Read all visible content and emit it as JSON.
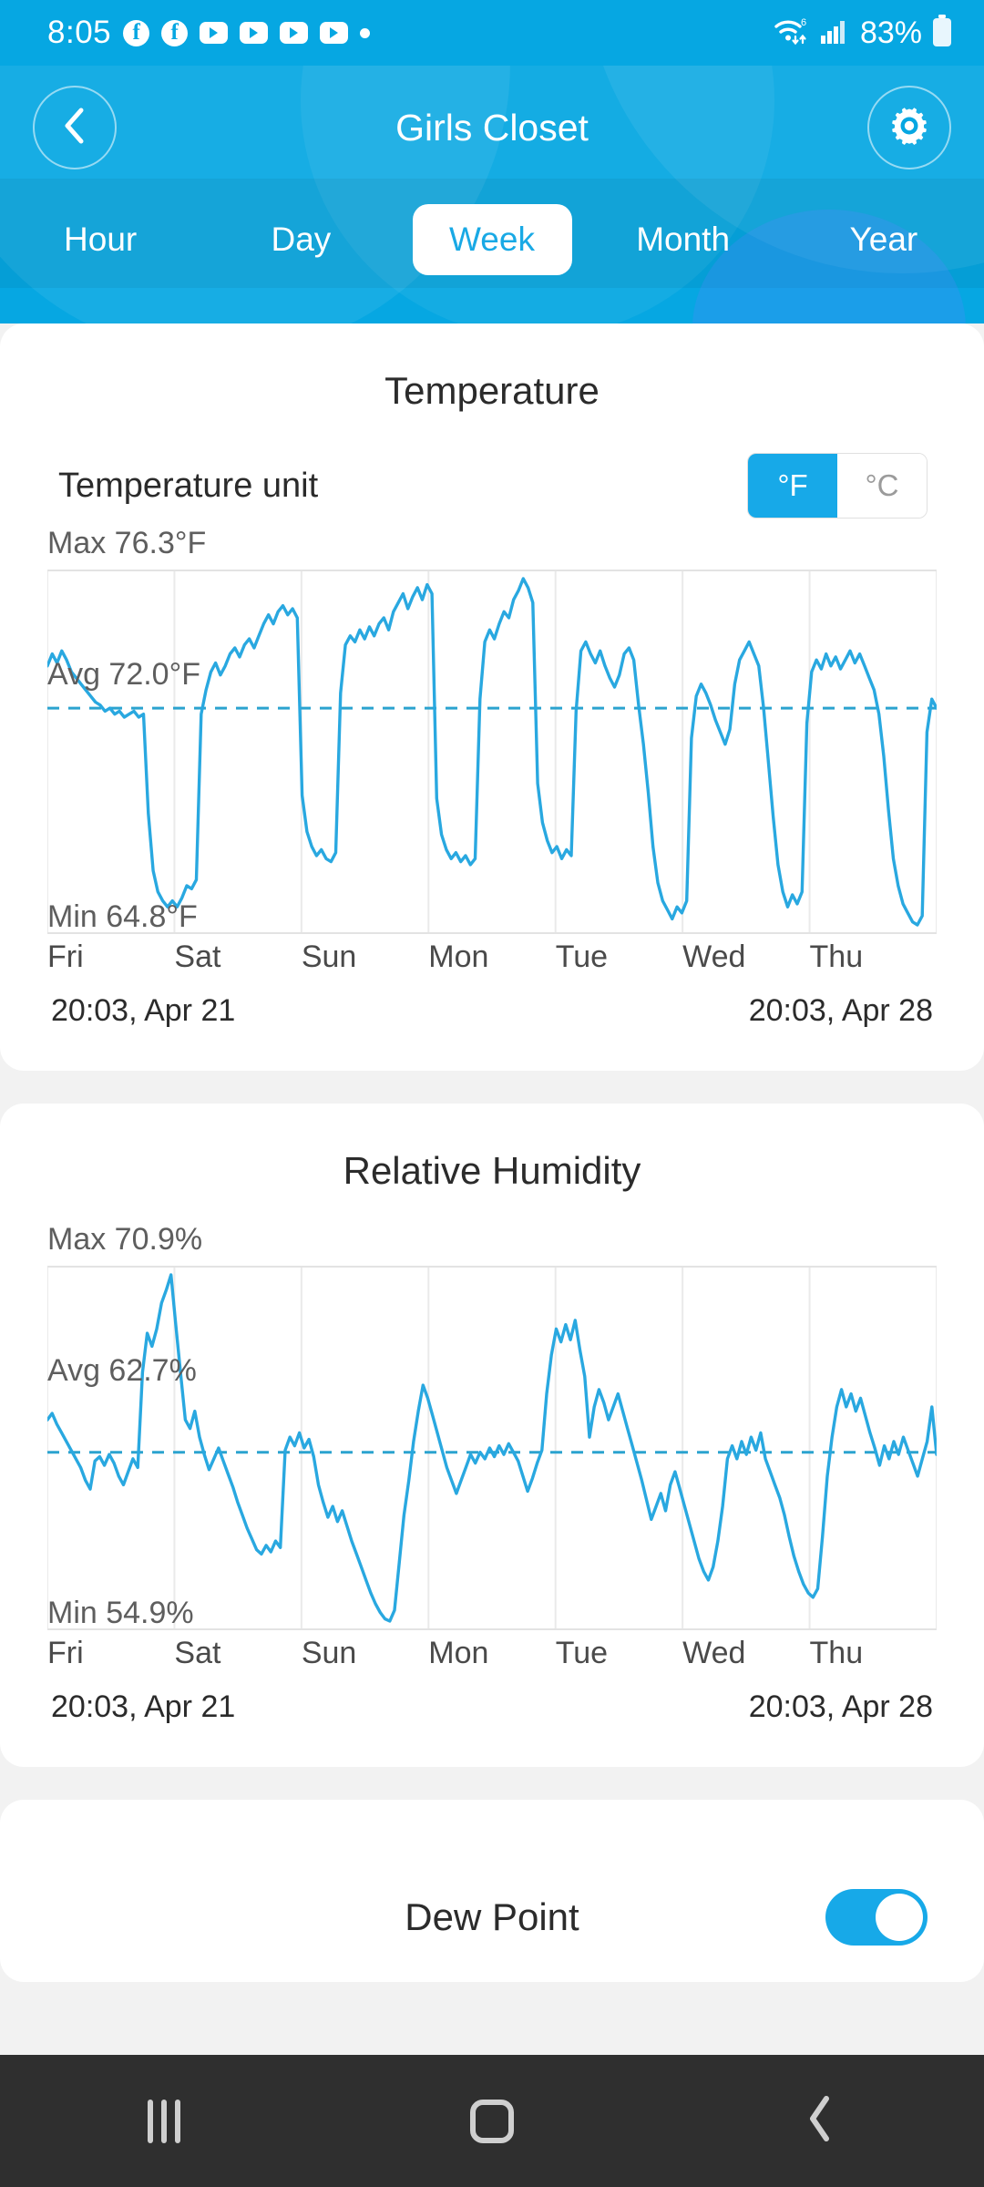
{
  "status_bar": {
    "time": "8:05",
    "icons": [
      "facebook-icon",
      "facebook-icon",
      "youtube-icon",
      "youtube-icon",
      "youtube-icon",
      "youtube-icon",
      "dot-icon"
    ],
    "wifi": "wifi-6-icon",
    "signal": "cellular-signal-icon",
    "battery_percent": "83%",
    "battery_icon": "battery-icon"
  },
  "header": {
    "back_icon": "chevron-left-icon",
    "title": "Girls Closet",
    "settings_icon": "gear-icon",
    "accent_color": "#06a7e2"
  },
  "tabs": [
    {
      "label": "Hour",
      "selected": false
    },
    {
      "label": "Day",
      "selected": false
    },
    {
      "label": "Week",
      "selected": true
    },
    {
      "label": "Month",
      "selected": false
    },
    {
      "label": "Year",
      "selected": false
    }
  ],
  "temperature_card": {
    "title": "Temperature",
    "unit_label": "Temperature unit",
    "unit_options": [
      "°F",
      "°C"
    ],
    "unit_selected": "°F",
    "max": "Max 76.3°F",
    "avg": "Avg 72.0°F",
    "min": "Min 64.8°F",
    "days": [
      "Fri",
      "Sat",
      "Sun",
      "Mon",
      "Tue",
      "Wed",
      "Thu"
    ],
    "range_start": "20:03,  Apr 21",
    "range_end": "20:03,  Apr 28"
  },
  "humidity_card": {
    "title": "Relative Humidity",
    "max": "Max 70.9%",
    "avg": "Avg 62.7%",
    "min": "Min 54.9%",
    "days": [
      "Fri",
      "Sat",
      "Sun",
      "Mon",
      "Tue",
      "Wed",
      "Thu"
    ],
    "range_start": "20:03,  Apr 21",
    "range_end": "20:03,  Apr 28"
  },
  "dew_point_card": {
    "title": "Dew Point",
    "toggle_on": true
  },
  "nav_bar": {
    "recents_icon": "recents-icon",
    "home_icon": "home-icon",
    "back_icon": "back-chevron-icon"
  },
  "chart_data": [
    {
      "type": "line",
      "title": "Temperature",
      "ylabel": "°F",
      "xlabel": "",
      "unit": "°F",
      "max": 76.3,
      "avg": 72.0,
      "min": 64.8,
      "ylim": [
        64.8,
        76.3
      ],
      "grid": true,
      "legend": "none",
      "avg_line": 72.0,
      "categories": [
        "Fri",
        "Sat",
        "Sun",
        "Mon",
        "Tue",
        "Wed",
        "Thu"
      ],
      "x_start": "20:03, Apr 21",
      "x_end": "20:03, Apr 28",
      "line_color": "#29a8e0",
      "values": [
        73.4,
        73.8,
        73.5,
        73.9,
        73.6,
        73.2,
        73.0,
        72.8,
        72.6,
        72.4,
        72.2,
        72.1,
        71.9,
        72.0,
        71.8,
        71.9,
        71.7,
        71.8,
        71.9,
        71.7,
        71.8,
        68.5,
        66.6,
        65.9,
        65.6,
        65.4,
        65.6,
        65.4,
        65.7,
        66.1,
        66.0,
        66.3,
        71.8,
        72.6,
        73.2,
        73.5,
        73.1,
        73.4,
        73.8,
        74.0,
        73.7,
        74.1,
        74.3,
        74.0,
        74.4,
        74.8,
        75.1,
        74.8,
        75.2,
        75.4,
        75.1,
        75.3,
        75.0,
        69.1,
        67.9,
        67.4,
        67.1,
        67.3,
        67.0,
        66.9,
        67.2,
        72.5,
        74.1,
        74.4,
        74.2,
        74.6,
        74.3,
        74.7,
        74.4,
        74.8,
        75.0,
        74.6,
        75.2,
        75.5,
        75.8,
        75.3,
        75.7,
        76.0,
        75.6,
        76.1,
        75.8,
        69.0,
        67.8,
        67.3,
        67.0,
        67.2,
        66.9,
        67.1,
        66.8,
        67.0,
        72.3,
        74.2,
        74.6,
        74.3,
        74.8,
        75.2,
        75.0,
        75.6,
        75.9,
        76.3,
        76.0,
        75.5,
        69.5,
        68.2,
        67.6,
        67.2,
        67.4,
        67.0,
        67.3,
        67.1,
        71.9,
        73.9,
        74.2,
        73.8,
        73.5,
        73.9,
        73.4,
        73.0,
        72.7,
        73.1,
        73.8,
        74.0,
        73.6,
        72.1,
        70.8,
        69.2,
        67.4,
        66.2,
        65.6,
        65.3,
        65.0,
        65.4,
        65.2,
        65.6,
        71.0,
        72.4,
        72.8,
        72.5,
        72.1,
        71.6,
        71.2,
        70.8,
        71.3,
        72.8,
        73.6,
        73.9,
        74.2,
        73.8,
        73.4,
        72.0,
        70.2,
        68.4,
        66.8,
        65.9,
        65.4,
        65.8,
        65.5,
        65.9,
        71.5,
        73.2,
        73.6,
        73.3,
        73.8,
        73.4,
        73.7,
        73.3,
        73.6,
        73.9,
        73.5,
        73.8,
        73.4,
        73.0,
        72.6,
        71.8,
        70.4,
        68.6,
        67.0,
        66.1,
        65.5,
        65.2,
        64.9,
        64.8,
        65.1,
        71.2,
        72.3,
        72.0
      ]
    },
    {
      "type": "line",
      "title": "Relative Humidity",
      "ylabel": "%",
      "xlabel": "",
      "unit": "%",
      "max": 70.9,
      "avg": 62.7,
      "min": 54.9,
      "ylim": [
        54.9,
        70.9
      ],
      "grid": true,
      "legend": "none",
      "avg_line": 62.7,
      "categories": [
        "Fri",
        "Sat",
        "Sun",
        "Mon",
        "Tue",
        "Wed",
        "Thu"
      ],
      "x_start": "20:03, Apr 21",
      "x_end": "20:03, Apr 28",
      "line_color": "#29a8e0",
      "values": [
        64.2,
        64.5,
        64.0,
        63.6,
        63.2,
        62.8,
        62.4,
        62.0,
        61.4,
        61.0,
        62.3,
        62.5,
        62.1,
        62.6,
        62.2,
        61.6,
        61.2,
        61.8,
        62.4,
        62.0,
        66.4,
        68.2,
        67.6,
        68.4,
        69.6,
        70.2,
        70.9,
        68.6,
        66.4,
        64.2,
        63.8,
        64.6,
        63.4,
        62.6,
        61.9,
        62.4,
        62.9,
        62.3,
        61.7,
        61.1,
        60.4,
        59.8,
        59.2,
        58.7,
        58.2,
        58.0,
        58.4,
        58.1,
        58.6,
        58.3,
        62.8,
        63.4,
        63.0,
        63.6,
        62.9,
        63.3,
        62.5,
        61.2,
        60.4,
        59.7,
        60.2,
        59.5,
        60.0,
        59.3,
        58.6,
        58.0,
        57.4,
        56.8,
        56.2,
        55.7,
        55.3,
        55.0,
        54.9,
        55.4,
        57.6,
        59.8,
        61.4,
        63.2,
        64.6,
        65.8,
        65.2,
        64.4,
        63.6,
        62.8,
        62.0,
        61.4,
        60.8,
        61.4,
        62.0,
        62.6,
        62.2,
        62.7,
        62.4,
        62.9,
        62.5,
        63.0,
        62.6,
        63.1,
        62.7,
        62.3,
        61.6,
        60.9,
        61.5,
        62.2,
        62.8,
        65.4,
        67.2,
        68.4,
        67.8,
        68.6,
        67.9,
        68.8,
        67.4,
        66.2,
        63.4,
        64.8,
        65.6,
        65.0,
        64.2,
        64.8,
        65.4,
        64.6,
        63.8,
        63.0,
        62.2,
        61.4,
        60.5,
        59.6,
        60.2,
        60.8,
        60.0,
        61.2,
        61.8,
        61.0,
        60.2,
        59.4,
        58.6,
        57.8,
        57.2,
        56.8,
        57.4,
        58.6,
        60.2,
        62.4,
        63.0,
        62.4,
        63.2,
        62.6,
        63.4,
        62.8,
        63.6,
        62.4,
        61.8,
        61.2,
        60.6,
        59.8,
        58.8,
        57.9,
        57.2,
        56.6,
        56.2,
        56.0,
        56.4,
        58.8,
        61.6,
        63.4,
        64.8,
        65.6,
        64.8,
        65.4,
        64.6,
        65.2,
        64.4,
        63.6,
        62.9,
        62.1,
        63.0,
        62.4,
        63.2,
        62.6,
        63.4,
        62.8,
        62.2,
        61.6,
        62.4,
        63.2,
        64.8,
        62.6
      ]
    }
  ]
}
